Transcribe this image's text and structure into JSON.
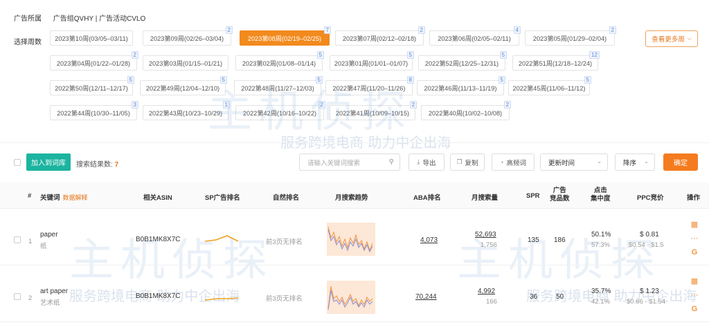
{
  "header": {
    "owner_label": "广告所属",
    "owner_value": "广告组QVHY | 广告活动CVLO",
    "week_label": "选择周数",
    "more_weeks": "查看更多周"
  },
  "weeks": [
    {
      "label": "2023第10周(03/05–03/11)",
      "count": ""
    },
    {
      "label": "2023第09周(02/26–03/04)",
      "count": "2"
    },
    {
      "label": "2023第08周(02/19–02/25)",
      "count": "7",
      "active": true
    },
    {
      "label": "2023第07周(02/12–02/18)",
      "count": "2"
    },
    {
      "label": "2023第06周(02/05–02/11)",
      "count": "4"
    },
    {
      "label": "2023第05周(01/29–02/04)",
      "count": "2"
    },
    {
      "label": "2023第04周(01/22–01/28)",
      "count": "2"
    },
    {
      "label": "2023第03周(01/15–01/21)",
      "count": ""
    },
    {
      "label": "2023第02周(01/08–01/14)",
      "count": "5"
    },
    {
      "label": "2023第01周(01/01–01/07)",
      "count": "5"
    },
    {
      "label": "2022第52周(12/25–12/31)",
      "count": "5"
    },
    {
      "label": "2022第51周(12/18–12/24)",
      "count": "12"
    },
    {
      "label": "2022第50周(12/11–12/17)",
      "count": "5"
    },
    {
      "label": "2022第49周(12/04–12/10)",
      "count": "5"
    },
    {
      "label": "2022第48周(11/27–12/03)",
      "count": "5"
    },
    {
      "label": "2022第47周(11/20–11/26)",
      "count": "8"
    },
    {
      "label": "2022第46周(11/13–11/19)",
      "count": "5"
    },
    {
      "label": "2022第45周(11/06–11/12)",
      "count": "5"
    },
    {
      "label": "2022第44周(10/30–11/05)",
      "count": "3"
    },
    {
      "label": "2022第43周(10/23–10/29)",
      "count": "1"
    },
    {
      "label": "2022第42周(10/16–10/22)",
      "count": "2"
    },
    {
      "label": "2022第41周(10/09–10/15)",
      "count": "2"
    },
    {
      "label": "2022第40周(10/02–10/08)",
      "count": "2"
    }
  ],
  "toolbar": {
    "add_btn": "加入到词库",
    "result_label": "搜索结果数:",
    "result_count": "7",
    "search_placeholder": "请输入关键词搜索",
    "export": "导出",
    "copy": "复制",
    "hot_words": "高频词",
    "sort_field": "更新时间",
    "sort_order": "降序",
    "confirm": "确定"
  },
  "table": {
    "headers": {
      "index": "#",
      "keyword": "关键词",
      "data_explain": "数据解释",
      "asin": "相关ASIN",
      "sp_rank": "SP广告排名",
      "natural_rank": "自然排名",
      "trend": "月搜索趋势",
      "aba_rank": "ABA排名",
      "monthly_search": "月搜索量",
      "spr": "SPR",
      "ad_products_1": "广告",
      "ad_products_2": "竞品数",
      "click_conc_1": "点击",
      "click_conc_2": "集中度",
      "ppc": "PPC竞价",
      "action": "操作"
    },
    "rows": [
      {
        "index": "1",
        "keyword": "paper",
        "keyword_cn": "纸",
        "asin": "B0B1MK8X7C",
        "natural_rank": "前3页无排名",
        "aba_rank": "4,073",
        "search_main": "52,693",
        "search_sub": "1,756",
        "spr": "135",
        "ad_products": "186",
        "click_main": "50.1%",
        "click_sub": "57.3%",
        "ppc_main": "$ 0.81",
        "ppc_sub": "$0.54 - $1.5"
      },
      {
        "index": "2",
        "keyword": "art paper",
        "keyword_cn": "艺术纸",
        "asin": "B0B1MK8X7C",
        "natural_rank": "前3页无排名",
        "aba_rank": "70,244",
        "search_main": "4,992",
        "search_sub": "166",
        "spr": "36",
        "ad_products": "50",
        "click_main": "35.7%",
        "click_sub": "42.1%",
        "ppc_main": "$ 1.23",
        "ppc_sub": "$0.66 - $1.54"
      }
    ]
  },
  "watermark": {
    "text": "主机侦探",
    "slogan": "服务跨境电商 助力中企出海"
  },
  "colors": {
    "accent": "#f57b1f",
    "green": "#1cb4a0",
    "badge_blue": "#5b8bd6"
  }
}
